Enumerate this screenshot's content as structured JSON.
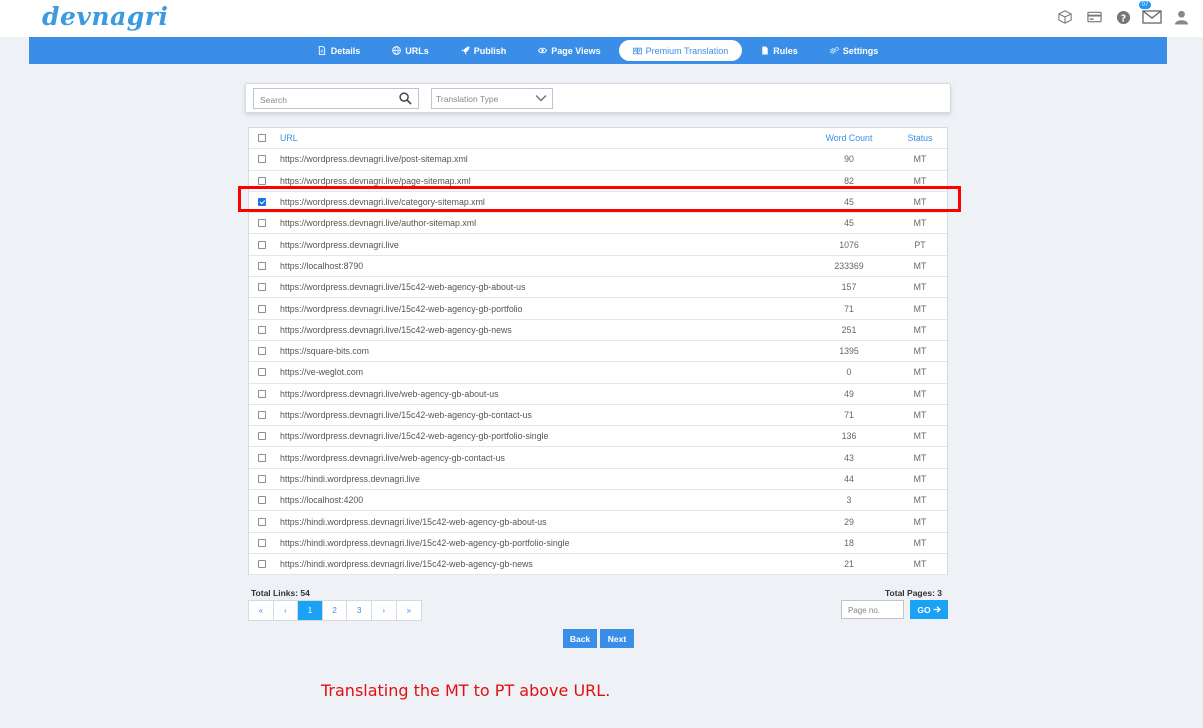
{
  "app": {
    "logo_text": "devnagri"
  },
  "header": {
    "notification_count": "07"
  },
  "nav": {
    "tabs": [
      {
        "label": "Details",
        "icon": "document-icon",
        "active": false
      },
      {
        "label": "URLs",
        "icon": "globe-icon",
        "active": false
      },
      {
        "label": "Publish",
        "icon": "rocket-icon",
        "active": false
      },
      {
        "label": "Page Views",
        "icon": "eye-icon",
        "active": false
      },
      {
        "label": "Premium Translation",
        "icon": "translate-icon",
        "active": true
      },
      {
        "label": "Rules",
        "icon": "file-icon",
        "active": false
      },
      {
        "label": "Settings",
        "icon": "gears-icon",
        "active": false
      }
    ]
  },
  "filters": {
    "search_placeholder": "Search",
    "type_placeholder": "Translation Type"
  },
  "table": {
    "headers": {
      "url": "URL",
      "word_count": "Word Count",
      "status": "Status"
    },
    "rows": [
      {
        "url": "https://wordpress.devnagri.live/post-sitemap.xml",
        "word_count": "90",
        "status": "MT",
        "checked": false
      },
      {
        "url": "https://wordpress.devnagri.live/page-sitemap.xml",
        "word_count": "82",
        "status": "MT",
        "checked": false
      },
      {
        "url": "https://wordpress.devnagri.live/category-sitemap.xml",
        "word_count": "45",
        "status": "MT",
        "checked": true
      },
      {
        "url": "https://wordpress.devnagri.live/author-sitemap.xml",
        "word_count": "45",
        "status": "MT",
        "checked": false
      },
      {
        "url": "https://wordpress.devnagri.live",
        "word_count": "1076",
        "status": "PT",
        "checked": false
      },
      {
        "url": "https://localhost:8790",
        "word_count": "233369",
        "status": "MT",
        "checked": false
      },
      {
        "url": "https://wordpress.devnagri.live/15c42-web-agency-gb-about-us",
        "word_count": "157",
        "status": "MT",
        "checked": false
      },
      {
        "url": "https://wordpress.devnagri.live/15c42-web-agency-gb-portfolio",
        "word_count": "71",
        "status": "MT",
        "checked": false
      },
      {
        "url": "https://wordpress.devnagri.live/15c42-web-agency-gb-news",
        "word_count": "251",
        "status": "MT",
        "checked": false
      },
      {
        "url": "https://square-bits.com",
        "word_count": "1395",
        "status": "MT",
        "checked": false
      },
      {
        "url": "https://ve-weglot.com",
        "word_count": "0",
        "status": "MT",
        "checked": false
      },
      {
        "url": "https://wordpress.devnagri.live/web-agency-gb-about-us",
        "word_count": "49",
        "status": "MT",
        "checked": false
      },
      {
        "url": "https://wordpress.devnagri.live/15c42-web-agency-gb-contact-us",
        "word_count": "71",
        "status": "MT",
        "checked": false
      },
      {
        "url": "https://wordpress.devnagri.live/15c42-web-agency-gb-portfolio-single",
        "word_count": "136",
        "status": "MT",
        "checked": false
      },
      {
        "url": "https://wordpress.devnagri.live/web-agency-gb-contact-us",
        "word_count": "43",
        "status": "MT",
        "checked": false
      },
      {
        "url": "https://hindi.wordpress.devnagri.live",
        "word_count": "44",
        "status": "MT",
        "checked": false
      },
      {
        "url": "https://localhost:4200",
        "word_count": "3",
        "status": "MT",
        "checked": false
      },
      {
        "url": "https://hindi.wordpress.devnagri.live/15c42-web-agency-gb-about-us",
        "word_count": "29",
        "status": "MT",
        "checked": false
      },
      {
        "url": "https://hindi.wordpress.devnagri.live/15c42-web-agency-gb-portfolio-single",
        "word_count": "18",
        "status": "MT",
        "checked": false
      },
      {
        "url": "https://hindi.wordpress.devnagri.live/15c42-web-agency-gb-news",
        "word_count": "21",
        "status": "MT",
        "checked": false
      }
    ]
  },
  "footer": {
    "total_links": "Total Links: 54",
    "total_pages": "Total Pages: 3",
    "pager": [
      "«",
      "‹",
      "1",
      "2",
      "3",
      "›",
      "»"
    ],
    "active_page": "1",
    "page_input_placeholder": "Page no.",
    "go_label": "GO",
    "back_label": "Back",
    "next_label": "Next"
  },
  "caption": "Translating the MT to PT above URL.",
  "colors": {
    "primary": "#3b8ee8",
    "accent": "#1aa3f5",
    "highlight": "#ff0000"
  }
}
